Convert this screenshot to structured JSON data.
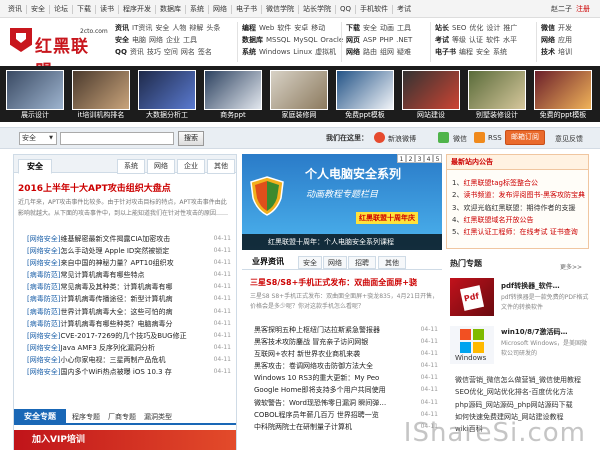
{
  "topnav": [
    "资讯",
    "安全",
    "论坛",
    "下载",
    "读书",
    "程序开发",
    "数据库",
    "系统",
    "网络",
    "电子书",
    "微信学院",
    "站长学院",
    "QQ",
    "手机软件",
    "考试"
  ],
  "user": {
    "name": "赵二子",
    "register": "注册"
  },
  "logo": {
    "text": "红黑联盟",
    "sub": "2cto.com"
  },
  "categories": {
    "g1": [
      [
        "资讯",
        "IT资讯",
        "安全",
        "人物",
        "辩解",
        "头条"
      ],
      [
        "安全",
        "电脑",
        "网络",
        "企业",
        "工具"
      ],
      [
        "QQ",
        "资讯",
        "技巧",
        "空间",
        "网名",
        "签名"
      ]
    ],
    "g2": [
      [
        "编程",
        "Web",
        "软件",
        "安卓",
        "移动"
      ],
      [
        "数据库",
        "MSSQL",
        "MySQL",
        "Oracle"
      ],
      [
        "系统",
        "Windows",
        "Linux",
        "虚拟机"
      ]
    ],
    "g3": [
      [
        "下载",
        "安全",
        "动画",
        "工具"
      ],
      [
        "网页",
        "ASP",
        "PHP",
        ".NET"
      ],
      [
        "网络",
        "路由",
        "组网",
        "疑难"
      ]
    ],
    "g4": [
      [
        "站长",
        "SEO",
        "优化",
        "设计",
        "推广"
      ],
      [
        "考试",
        "等级",
        "认证",
        "软件",
        "水平"
      ],
      [
        "电子书",
        "编程",
        "安全",
        "系统"
      ]
    ],
    "g5": [
      [
        "微信",
        "开发"
      ],
      [
        "网络",
        "应用"
      ],
      [
        "技术",
        "培训"
      ]
    ]
  },
  "thumbs": [
    "展示设计",
    "it培训机构排名",
    "大数据分析工",
    "商务ppt",
    "家庭装修网",
    "免费ppt模板",
    "网站建设",
    "别墅装修设计",
    "免费的ppt模板"
  ],
  "search": {
    "select": "安全",
    "button": "搜索",
    "placeholder": ""
  },
  "follow": {
    "label": "我们在这里：",
    "weibo": "新浪微博",
    "wechat": "微信",
    "rss": "RSS",
    "subscribe": "邮箱订阅",
    "feedback": "意见反馈"
  },
  "left": {
    "tabs": [
      "安全",
      "系统",
      "网络",
      "企业",
      "其他"
    ],
    "lead": "2016上半年十大APT攻击组织大盘点",
    "desc": "近几年来，APT攻击事件比较多。由于针对攻击目标的特点，APT攻击事件由此影响就越大。从下面的攻击事件中，到以上能知道我们在针对性攻击的原因……",
    "items": [
      {
        "tag": "[网络安全]",
        "title": "维基解密最新文件揭露CIA加密攻击",
        "date": "04-11"
      },
      {
        "tag": "[网络安全]",
        "title": "怎么手动处理 Apple ID突然被锁定",
        "date": "04-11"
      },
      {
        "tag": "[网络安全]",
        "title": "来自中国的神秘力量？APT10组织攻",
        "date": "04-11"
      },
      {
        "tag": "[病毒防范]",
        "title": "常见计算机病毒有哪些特点",
        "date": "04-11"
      },
      {
        "tag": "[病毒防范]",
        "title": "常见病毒及其种类：计算机病毒有哪",
        "date": "04-11"
      },
      {
        "tag": "[病毒防范]",
        "title": "计算机病毒传播途径：新型计算机病",
        "date": "04-11"
      },
      {
        "tag": "[病毒防范]",
        "title": "世界计算机病毒大全：这些可怕的病",
        "date": "04-11"
      },
      {
        "tag": "[病毒防范]",
        "title": "计算机病毒有哪些种类？电脑病毒分",
        "date": "04-11"
      },
      {
        "tag": "[网络安全]",
        "title": "CVE-2017-7269的几个技巧及BUG修正",
        "date": "04-11"
      },
      {
        "tag": "[网络安全]",
        "title": "Java AMF3 反序列化漏洞分析",
        "date": "04-11"
      },
      {
        "tag": "[网络安全]",
        "title": "小心你家电视：三星两制产品危机",
        "date": "04-11"
      },
      {
        "tag": "[网络安全]",
        "title": "国内多个WiFi热点被曝 iOS 10.3 存",
        "date": "04-11"
      }
    ],
    "sectabs": [
      "安全专题",
      "程序专题",
      "厂商专题",
      "漏洞类型"
    ],
    "vip": "加入VIP培训"
  },
  "feature": {
    "title": "个人电脑安全系列",
    "sub": "动画教程专题栏目",
    "badge": "红黑联盟十周年庆",
    "caption": "红黑联盟十周年：个人电脑安全系列课程",
    "dots": [
      "1",
      "2",
      "3",
      "4",
      "5"
    ]
  },
  "middle": {
    "tabs": [
      "业界资讯",
      "安全",
      "网络",
      "招聘",
      "其他"
    ],
    "lead": "三星S8/S8+手机正式发布：双曲面全面屏+骁",
    "desc": "三星S8 S8+手机正式发布：双曲面全面屏+骁龙835，4月21日开售，价格会是多少呢？你对这款手机怎么看呢？",
    "items": [
      {
        "title": "黑客探明五种上枢纽门达拉斯紧急警报器",
        "date": "04-11"
      },
      {
        "title": "黑客技术攻防鏖战 冒充亲子访问网银",
        "date": "04-11"
      },
      {
        "title": "互联网+农村 新世界农业商机来袭",
        "date": "04-11"
      },
      {
        "title": "黑客攻击：卷调网络攻击防御方法大全",
        "date": "04-11"
      },
      {
        "title": "Windows 10 RS3的重大更新：My Peo",
        "date": "04-11"
      },
      {
        "title": "Google Home即将支持多个用户共同使用",
        "date": "04-11"
      },
      {
        "title": "微软警告：Word现恐怖零日漏洞 瞬间弹…",
        "date": "04-11"
      },
      {
        "title": "COBOL程序员年薪几百万 世界招聘一览",
        "date": "04-11"
      },
      {
        "title": "中科院两院士在研制量子计算机",
        "date": "04-11"
      }
    ]
  },
  "right": {
    "notice_title": "最新站内公告",
    "notices": [
      {
        "a": "1、",
        "b": "红黑联盟tag标签整合公",
        "r": true
      },
      {
        "a": "2、",
        "b": "读书频道：发布评阅图书-黑客攻防宝典",
        "r": true
      },
      {
        "a": "3、",
        "b": "欢迎光临红黑联盟：期待作者的支援",
        "r": false
      },
      {
        "a": "4、",
        "b": "红黑联盟域名开放公告",
        "r": true
      },
      {
        "a": "5、",
        "b": "红黑认证工程师：在线考试 证书查询",
        "r": true
      }
    ],
    "top_title": "热门专题",
    "more": "更多>>",
    "topics": [
      {
        "title": "pdf转换器_软件…",
        "desc": "pdf转换器是一款免费的PDF格式文件的转换软件"
      },
      {
        "title": "win10/8/7激活码…",
        "desc": "Microsoft Windows，是美国微软公司研发的"
      }
    ],
    "links": [
      "微信营销_微信怎么做营销_微信使用教程",
      "SEO优化_网站优化排名-百度优化方法",
      "php源码_网站源码_php网站源码下载",
      "如何快速免费建网站_网站建设教程",
      "wiki百科"
    ]
  },
  "watermark": "IShareSi.com"
}
